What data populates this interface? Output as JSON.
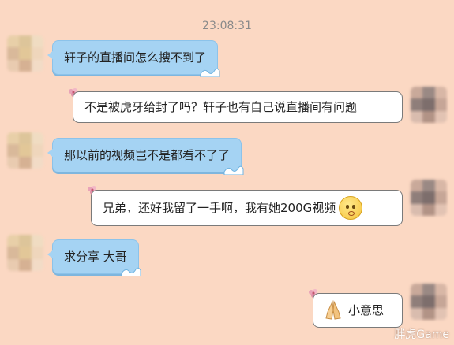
{
  "timestamp": "23:08:31",
  "messages": [
    {
      "side": "left",
      "text": "轩子的直播间怎么搜不到了"
    },
    {
      "side": "right",
      "text": "不是被虎牙给封了吗？轩子也有自己说直播间有问题"
    },
    {
      "side": "left",
      "text": "那以前的视频岂不是都看不了了"
    },
    {
      "side": "right",
      "text": "兄弟，还好我留了一手啊，我有她200G视频",
      "emoji": "embarrassed-smile-emoji"
    },
    {
      "side": "left",
      "text": "求分享 大哥"
    },
    {
      "side": "right",
      "text": "小意思",
      "emoji": "praying-hands-emoji"
    }
  ],
  "watermark": "胖虎Game",
  "colors": {
    "background": "#fbd8c3",
    "left_bubble": "#a5d3f3",
    "right_bubble": "#ffffff"
  }
}
